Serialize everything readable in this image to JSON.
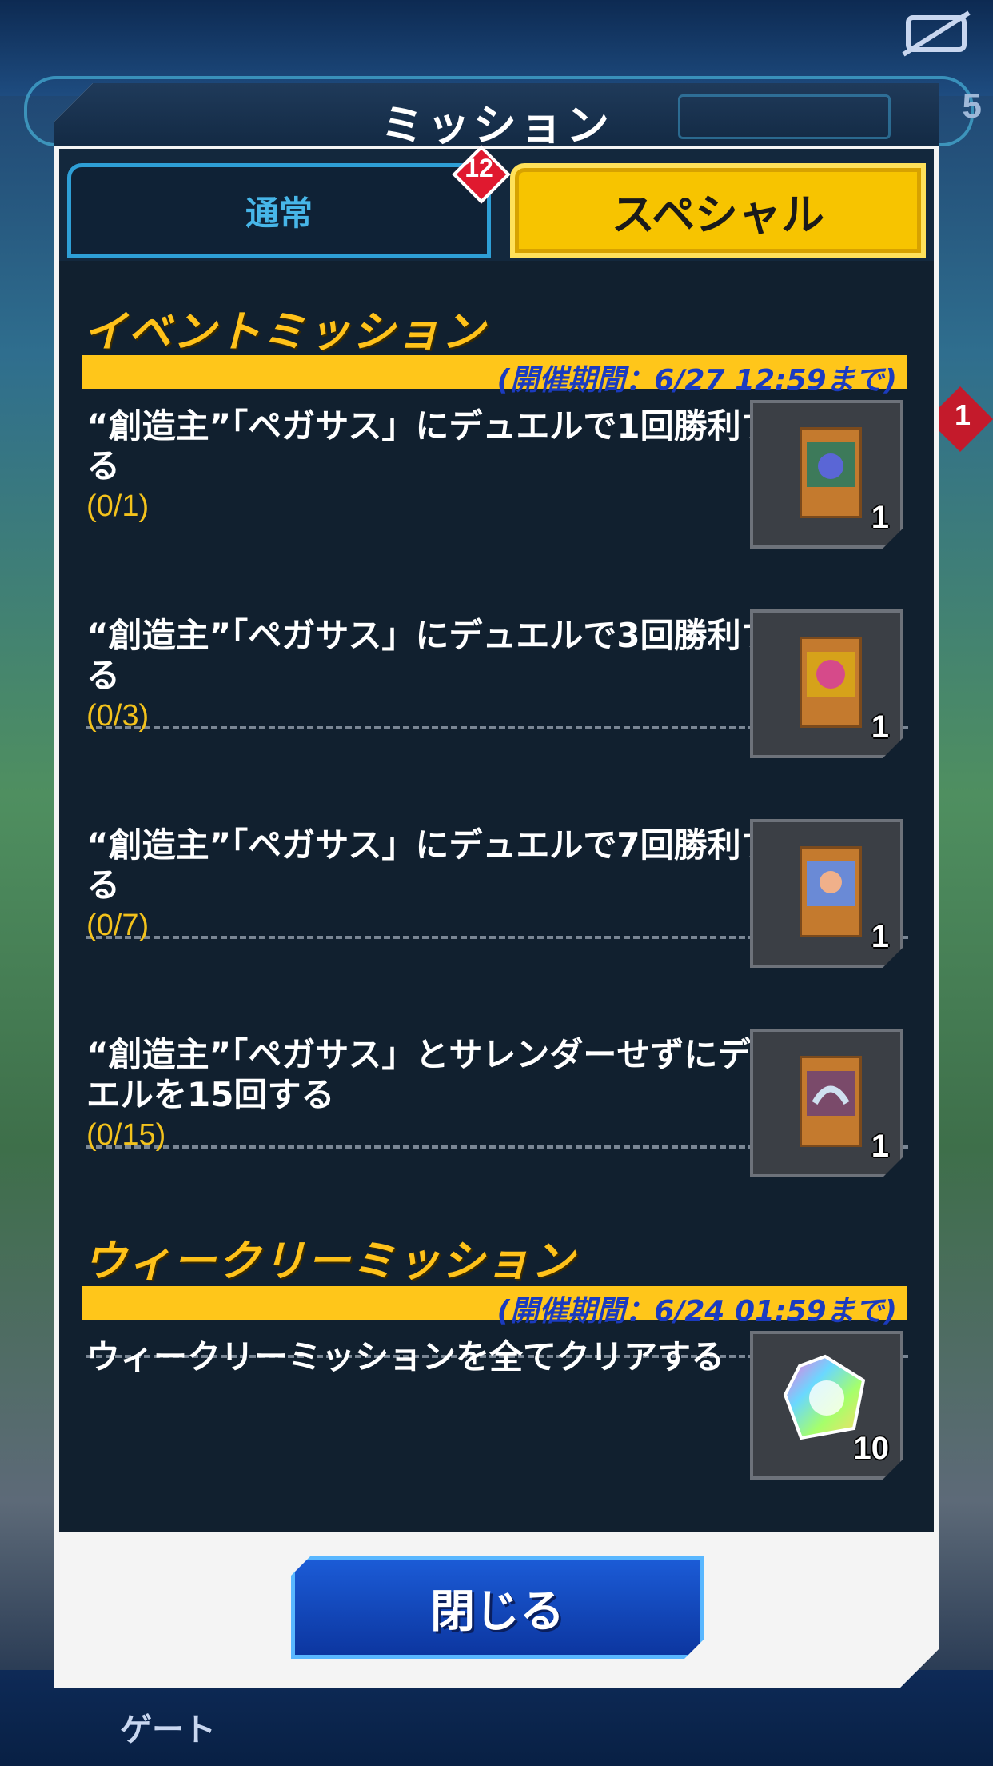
{
  "background": {
    "right_number": "5",
    "right_badge": "1",
    "bottom_nav_label": "ゲート"
  },
  "modal": {
    "title": "ミッション",
    "tabs": [
      {
        "label": "通常",
        "badge": "12",
        "selected": false
      },
      {
        "label": "スペシャル",
        "selected": true
      }
    ],
    "sections": [
      {
        "title": "イベントミッション",
        "period": "(開催期間：6/27 12:59まで)",
        "missions": [
          {
            "text": "“創造主”「ペガサス」にデュエルで1回勝利する",
            "progress": "(0/1)",
            "reward_icon": "card-icon",
            "reward_count": "1"
          },
          {
            "text": "“創造主”「ペガサス」にデュエルで3回勝利する",
            "progress": "(0/3)",
            "reward_icon": "card-icon",
            "reward_count": "1"
          },
          {
            "text": "“創造主”「ペガサス」にデュエルで7回勝利する",
            "progress": "(0/7)",
            "reward_icon": "card-icon",
            "reward_count": "1"
          },
          {
            "text": "“創造主”「ペガサス」とサレンダーせずにデュエルを15回する",
            "progress": "(0/15)",
            "reward_icon": "card-icon",
            "reward_count": "1"
          }
        ]
      },
      {
        "title": "ウィークリーミッション",
        "period": "(開催期間：6/24 01:59まで)",
        "missions": [
          {
            "text": "ウィークリーミッションを全てクリアする",
            "progress": "",
            "reward_icon": "gem-icon",
            "reward_count": "10"
          }
        ]
      }
    ],
    "close_label": "閉じる"
  },
  "colors": {
    "accent_yellow": "#ffc61a",
    "tab_blue": "#2e9fd6",
    "period_text": "#1b3bbf",
    "panel_bg": "#11202f",
    "button_blue": "#1b5bd6"
  }
}
